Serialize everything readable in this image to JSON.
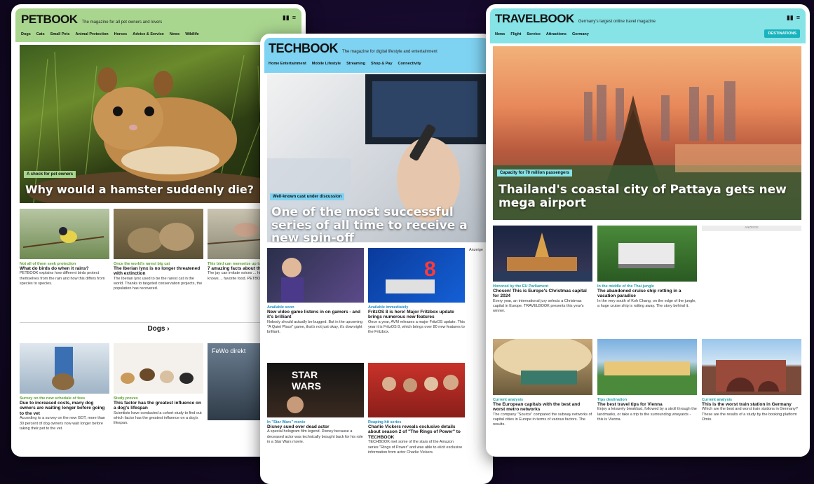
{
  "pet": {
    "brand": "PETBOOK",
    "tagline": "The magazine for all pet owners and lovers",
    "nav": [
      "Dogs",
      "Cats",
      "Small Pets",
      "Animal Protection",
      "Horses",
      "Advice & Service",
      "News",
      "Wildlife"
    ],
    "hero": {
      "badge": "A shock for pet owners",
      "headline": "Why would a hamster suddenly die?"
    },
    "articles": [
      {
        "kicker": "Not all of them seek protection",
        "headline": "What do birds do when it rains?",
        "teaser": "PETBOOK explains how different birds protect themselves from the rain and how this differs from species to species."
      },
      {
        "kicker": "Once the world's rarest big cat",
        "headline": "The Iberian lynx is no longer threatened with extinction",
        "teaser": "The Iberian lynx used to be the rarest cat in the world. Thanks to targeted conservation projects, the population has recovered."
      },
      {
        "kicker": "This bird can memorize up to ... places!",
        "headline": "7 amazing facts about the...",
        "teaser": "The jay can imitate voices ... hiding places and knows ... favorite food. PETBOOK ... about the jay."
      }
    ],
    "section_title": "Dogs ›",
    "dog_articles": [
      {
        "kicker": "Survey on the new schedule of fees",
        "headline": "Due to increased costs, many dog owners are waiting longer before going to the vet",
        "teaser": "According to a survey on the new GOT, more than 30 percent of dog owners now wait longer before taking their pet to the vet."
      },
      {
        "kicker": "Study proves",
        "headline": "This factor has the greatest influence on a dog's lifespan",
        "teaser": "Scientists have conducted a cohort study to find out which factor has the greatest influence on a dog's lifespan."
      }
    ],
    "ad_text": "FeWo direkt"
  },
  "tech": {
    "brand": "TECHBOOK",
    "tagline": "The magazine for digital lifestyle and entertainment",
    "nav": [
      "Home Entertainment",
      "Mobile Lifestyle",
      "Streaming",
      "Shop & Pay",
      "Connectivity"
    ],
    "hero": {
      "badge": "Well-known cast under discussion",
      "headline": "One of the most successful series of all time to receive a new spin-off"
    },
    "articles": [
      {
        "kicker": "Available soon",
        "headline": "New video game listens in on gamers - and it's brilliant",
        "teaser": "Nobody should actually be bugged. But in the upcoming \"A Quiet Place\" game, that's not just okay, it's downright brilliant."
      },
      {
        "kicker": "Available immediately",
        "headline": "FritzOS 8 is here! Major Fritzbox update brings numerous new features",
        "teaser": "Once a year, AVM releases a major FritzOS update. This year it is FritzOS 8, which brings over 80 new features to the Fritzbox."
      },
      {
        "kicker": "In \"Star Wars\" movie",
        "headline": "Disney sued over dead actor",
        "teaser": "A special hologram film legend. Disney because a deceased actor was technically brought back for his role in a Star Wars movie."
      },
      {
        "kicker": "Reaping hit series",
        "headline": "Charlie Vickers reveals exclusive details about season 2 of \"The Rings of Power\" to TECHBOOK",
        "teaser": "TECHBOOK met some of the stars of the Amazon series \"Rings of Power\" and was able to elicit exclusive information from actor Charlie Vickers."
      }
    ],
    "ad_label": "Anzeige"
  },
  "travel": {
    "brand": "TRAVELBOOK",
    "tagline": "Germany's largest online travel magazine",
    "nav": [
      "News",
      "Flight",
      "Service",
      "Attractions",
      "Germany"
    ],
    "dest_button": "DESTINATIONS",
    "hero": {
      "badge": "Capacity for 70 million passengers",
      "headline": "Thailand's coastal city of Pattaya gets new mega airport"
    },
    "ad_label": "ANZEIGE",
    "articles": [
      {
        "kicker": "Honored by the EU Parliament",
        "headline": "Chosen! This is Europe's Christmas capital for 2024",
        "teaser": "Every year, an international jury selects a Christmas capital in Europe. TRAVELBOOK presents this year's winner."
      },
      {
        "kicker": "In the middle of the Thai jungle",
        "headline": "The abandoned cruise ship rotting in a vacation paradise",
        "teaser": "In the very south of Koh Chang, on the edge of the jungle, a huge cruise ship is rotting away. The story behind it."
      },
      {
        "kicker": "Current analysis",
        "headline": "The European capitals with the best and worst metro networks",
        "teaser": "The company \"Source\" compared the subway networks of capital cities in Europe in terms of various factors. The results."
      },
      {
        "kicker": "Tips destination",
        "headline": "The best travel tips for Vienna",
        "teaser": "Enjoy a leisurely breakfast, followed by a stroll through the landmarks, or take a trip to the surrounding vineyards - this is Vienna."
      },
      {
        "kicker": "Current analysis",
        "headline": "This is the worst train station in Germany",
        "teaser": "Which are the best and worst train stations in Germany? These are the results of a study by the booking platform Omio."
      }
    ]
  }
}
